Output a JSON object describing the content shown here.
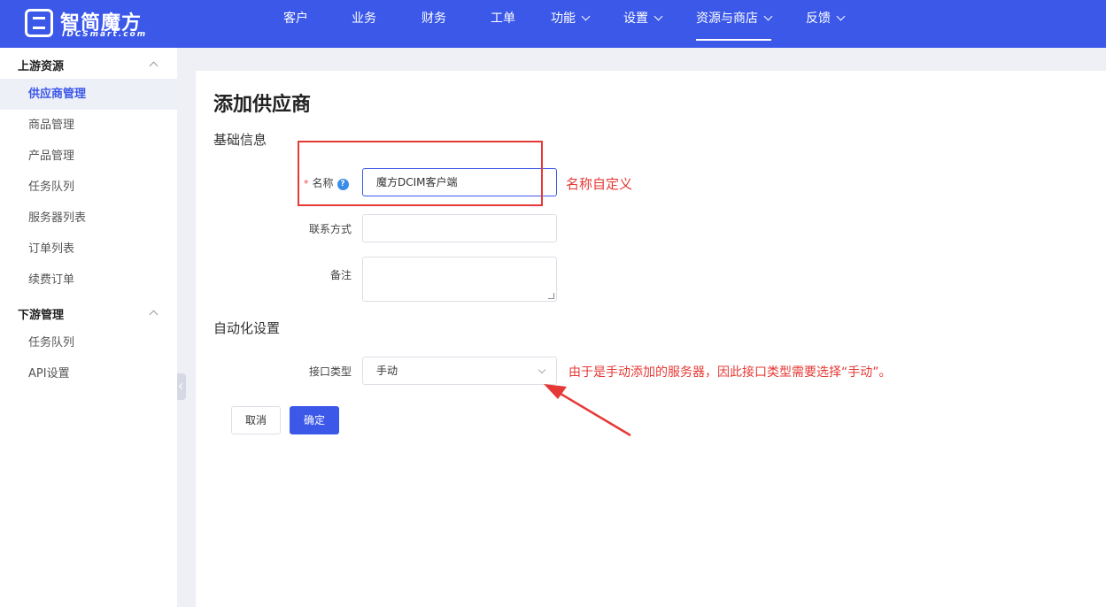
{
  "brand": {
    "name": "智简魔方",
    "sub": "IDCSmart.com"
  },
  "nav": {
    "items": [
      {
        "label": "客户",
        "dropdown": false,
        "active": false
      },
      {
        "label": "业务",
        "dropdown": false,
        "active": false
      },
      {
        "label": "财务",
        "dropdown": false,
        "active": false
      },
      {
        "label": "工单",
        "dropdown": false,
        "active": false
      },
      {
        "label": "功能",
        "dropdown": true,
        "active": false
      },
      {
        "label": "设置",
        "dropdown": true,
        "active": false
      },
      {
        "label": "资源与商店",
        "dropdown": true,
        "active": true
      },
      {
        "label": "反馈",
        "dropdown": true,
        "active": false
      }
    ]
  },
  "sidebar": {
    "groups": [
      {
        "label": "上游资源",
        "items": [
          "供应商管理",
          "商品管理",
          "产品管理",
          "任务队列",
          "服务器列表",
          "订单列表",
          "续费订单"
        ]
      },
      {
        "label": "下游管理",
        "items": [
          "任务队列",
          "API设置"
        ]
      }
    ],
    "active_item": "供应商管理"
  },
  "page": {
    "title": "添加供应商",
    "section_basic": "基础信息",
    "section_auto": "自动化设置"
  },
  "form": {
    "name_label": "名称",
    "name_required": "*",
    "help_icon": "?",
    "name_value": "魔方DCIM客户端",
    "contact_label": "联系方式",
    "contact_value": "",
    "note_label": "备注",
    "note_value": "",
    "interface_label": "接口类型",
    "interface_value": "手动"
  },
  "buttons": {
    "cancel": "取消",
    "confirm": "确定"
  },
  "annotations": {
    "name_note": "名称自定义",
    "interface_note": "由于是手动添加的服务器，因此接口类型需要选择“手动”。"
  },
  "colors": {
    "primary": "#3b58e9",
    "annotation": "#e53935"
  }
}
